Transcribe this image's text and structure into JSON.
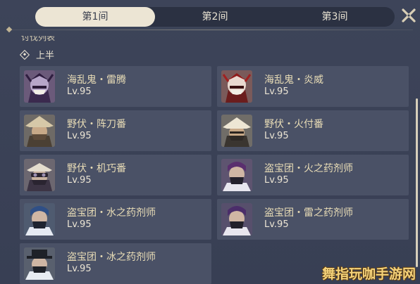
{
  "tabs": [
    {
      "label": "第1间",
      "active": true
    },
    {
      "label": "第2间",
      "active": false
    },
    {
      "label": "第3间",
      "active": false
    }
  ],
  "close_icon": "close-icon",
  "list_title": "讨伐列表",
  "section": {
    "label": "上半",
    "icon": "diamond-icon"
  },
  "enemies": [
    {
      "name": "海乱鬼・雷腾",
      "level": "Lv.95",
      "portrait": "samurai-purple"
    },
    {
      "name": "海乱鬼・炎威",
      "level": "Lv.95",
      "portrait": "samurai-red"
    },
    {
      "name": "野伏・阵刀番",
      "level": "Lv.95",
      "portrait": "ronin-hat"
    },
    {
      "name": "野伏・火付番",
      "level": "Lv.95",
      "portrait": "ronin-hat-light"
    },
    {
      "name": "野伏・机巧番",
      "level": "Lv.95",
      "portrait": "ronin-goggles"
    },
    {
      "name": "盗宝团・火之药剂师",
      "level": "Lv.95",
      "portrait": "treasure-hoarder-purple"
    },
    {
      "name": "盗宝团・水之药剂师",
      "level": "Lv.95",
      "portrait": "treasure-hoarder-blue"
    },
    {
      "name": "盗宝团・雷之药剂师",
      "level": "Lv.95",
      "portrait": "treasure-hoarder-violet"
    },
    {
      "name": "盗宝团・冰之药剂师",
      "level": "Lv.95",
      "portrait": "treasure-hoarder-hat"
    }
  ],
  "watermark": "舞指玩咖手游网",
  "colors": {
    "background": "#3a4156",
    "card": "#4a5166",
    "tab_active": "#ece5d4",
    "name_text": "#e8dcb6"
  }
}
